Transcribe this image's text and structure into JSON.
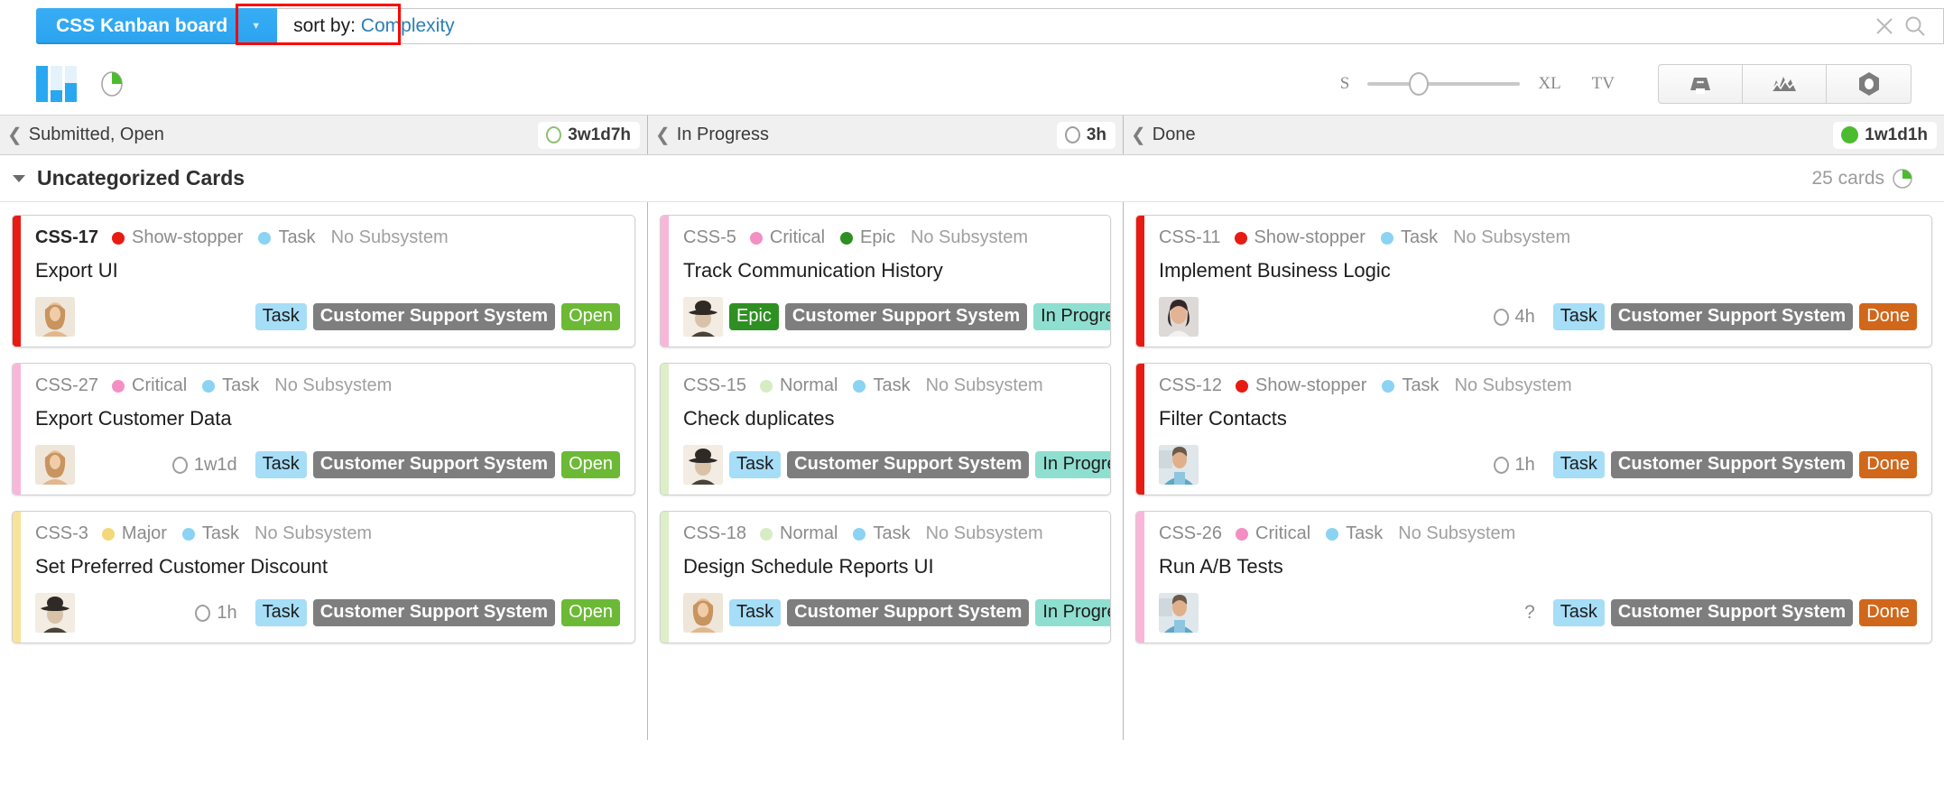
{
  "topbar": {
    "board_name": "CSS Kanban board",
    "caret": "▼",
    "search_prefix": "sort by: ",
    "search_field": "Complexity",
    "clear_icon": "close-icon",
    "search_icon": "search-icon"
  },
  "toolbar": {
    "board_view_icon": "board-bars-icon",
    "chart_view_icon": "pie-chart-icon",
    "size_min_label": "S",
    "size_max_label": "XL",
    "tv_label": "TV",
    "buttons": [
      {
        "name": "archive-button",
        "icon": "archive-box-icon"
      },
      {
        "name": "chart-button",
        "icon": "line-chart-icon"
      },
      {
        "name": "settings-button",
        "icon": "nut-gear-icon"
      }
    ]
  },
  "columns": [
    {
      "title": "Submitted, Open",
      "time": "3w1d7h",
      "indicator": "ring"
    },
    {
      "title": "In Progress",
      "time": "3h",
      "indicator": "ring"
    },
    {
      "title": "Done",
      "time": "1w1d1h",
      "indicator": "dot-green"
    }
  ],
  "swimlane": {
    "title": "Uncategorized Cards",
    "card_count": "25 cards",
    "progress_icon": "pie-progress-icon"
  },
  "colors": {
    "accent_blue": "#2aa3f0",
    "show_stopper": "#e81b12",
    "critical": "#f48fc4",
    "major": "#f2d87a",
    "normal": "#d6ecc2",
    "task_type": "#8bd3f2",
    "epic_type": "#2e9022",
    "status_open": "#6cb936",
    "status_in_progress": "#8fdfd0",
    "status_done": "#d1671a",
    "annotation_box": "#ff0000"
  },
  "cards": {
    "open": [
      {
        "id": "CSS-17",
        "id_strong": true,
        "priority": "Show-stopper",
        "priority_color": "#e81b12",
        "type": "Task",
        "type_color": "#8bd3f2",
        "subsystem": "No Subsystem",
        "title": "Export UI",
        "estimate": "",
        "estimate_kind": "none",
        "badges": {
          "type": "Task",
          "type_class": "type-task",
          "project": "Customer Support System",
          "status": "Open",
          "status_class": "st-open"
        },
        "avatar": "woman-long-hair-avatar",
        "bar_color": "#e81b12"
      },
      {
        "id": "CSS-27",
        "id_strong": false,
        "priority": "Critical",
        "priority_color": "#f48fc4",
        "type": "Task",
        "type_color": "#8bd3f2",
        "subsystem": "No Subsystem",
        "title": "Export Customer Data",
        "estimate": "1w1d",
        "estimate_kind": "ring",
        "badges": {
          "type": "Task",
          "type_class": "type-task",
          "project": "Customer Support System",
          "status": "Open",
          "status_class": "st-open"
        },
        "avatar": "woman-long-hair-avatar",
        "bar_color": "#f9b6d9"
      },
      {
        "id": "CSS-3",
        "id_strong": false,
        "priority": "Major",
        "priority_color": "#f2d87a",
        "type": "Task",
        "type_color": "#8bd3f2",
        "subsystem": "No Subsystem",
        "title": "Set Preferred Customer Discount",
        "estimate": "1h",
        "estimate_kind": "ring",
        "badges": {
          "type": "Task",
          "type_class": "type-task",
          "project": "Customer Support System",
          "status": "Open",
          "status_class": "st-open"
        },
        "avatar": "man-hat-avatar",
        "bar_color": "#f7e39a"
      }
    ],
    "in_progress": [
      {
        "id": "CSS-5",
        "id_strong": false,
        "priority": "Critical",
        "priority_color": "#f48fc4",
        "type": "Epic",
        "type_color": "#2e9022",
        "subsystem": "No Subsystem",
        "title": "Track Communication History",
        "estimate": "",
        "estimate_kind": "none",
        "badges": {
          "type": "Epic",
          "type_class": "type-epic",
          "project": "Customer Support System",
          "status": "In Progress",
          "status_class": "st-inprogress"
        },
        "avatar": "man-hat-avatar",
        "bar_color": "#f9b6d9"
      },
      {
        "id": "CSS-15",
        "id_strong": false,
        "priority": "Normal",
        "priority_color": "#d6ecc2",
        "type": "Task",
        "type_color": "#8bd3f2",
        "subsystem": "No Subsystem",
        "title": "Check duplicates",
        "estimate": "",
        "estimate_kind": "none",
        "badges": {
          "type": "Task",
          "type_class": "type-task",
          "project": "Customer Support System",
          "status": "In Progress",
          "status_class": "st-inprogress"
        },
        "avatar": "man-hat-avatar",
        "bar_color": "#dcefc7"
      },
      {
        "id": "CSS-18",
        "id_strong": false,
        "priority": "Normal",
        "priority_color": "#d6ecc2",
        "type": "Task",
        "type_color": "#8bd3f2",
        "subsystem": "No Subsystem",
        "title": "Design Schedule Reports UI",
        "estimate": "",
        "estimate_kind": "none",
        "badges": {
          "type": "Task",
          "type_class": "type-task",
          "project": "Customer Support System",
          "status": "In Progress",
          "status_class": "st-inprogress"
        },
        "avatar": "woman-long-hair-avatar",
        "bar_color": "#dcefc7"
      }
    ],
    "done": [
      {
        "id": "CSS-11",
        "id_strong": false,
        "priority": "Show-stopper",
        "priority_color": "#e81b12",
        "type": "Task",
        "type_color": "#8bd3f2",
        "subsystem": "No Subsystem",
        "title": "Implement Business Logic",
        "estimate": "4h",
        "estimate_kind": "ring",
        "badges": {
          "type": "Task",
          "type_class": "type-task",
          "project": "Customer Support System",
          "status": "Done",
          "status_class": "st-done"
        },
        "avatar": "woman-dark-hair-avatar",
        "bar_color": "#e81b12"
      },
      {
        "id": "CSS-12",
        "id_strong": false,
        "priority": "Show-stopper",
        "priority_color": "#e81b12",
        "type": "Task",
        "type_color": "#8bd3f2",
        "subsystem": "No Subsystem",
        "title": "Filter Contacts",
        "estimate": "1h",
        "estimate_kind": "ring",
        "badges": {
          "type": "Task",
          "type_class": "type-task",
          "project": "Customer Support System",
          "status": "Done",
          "status_class": "st-done"
        },
        "avatar": "man-blue-shirt-avatar",
        "bar_color": "#e81b12"
      },
      {
        "id": "CSS-26",
        "id_strong": false,
        "priority": "Critical",
        "priority_color": "#f48fc4",
        "type": "Task",
        "type_color": "#8bd3f2",
        "subsystem": "No Subsystem",
        "title": "Run A/B Tests",
        "estimate": "?",
        "estimate_kind": "question",
        "badges": {
          "type": "Task",
          "type_class": "type-task",
          "project": "Customer Support System",
          "status": "Done",
          "status_class": "st-done"
        },
        "avatar": "man-blue-shirt-avatar",
        "bar_color": "#f9b6d9"
      }
    ]
  }
}
